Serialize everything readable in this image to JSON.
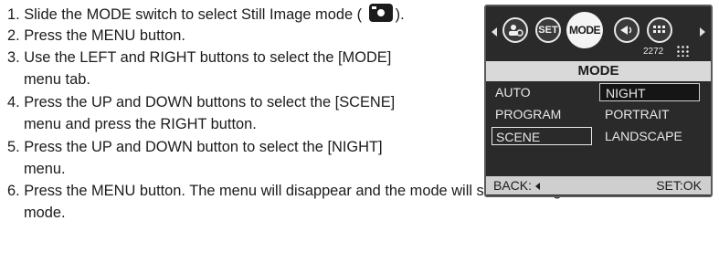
{
  "steps": [
    {
      "number": "1.",
      "text_before": "Slide the MODE switch to select Still Image mode (",
      "text_after": ").",
      "icon": "camera-icon"
    },
    {
      "number": "2.",
      "text": "Press the MENU button."
    },
    {
      "number": "3.",
      "text_line1": "Use the LEFT and RIGHT buttons to select the [MODE]",
      "text_line2": "menu tab."
    },
    {
      "number": "4.",
      "text_line1": "Press the UP and DOWN buttons to select the [SCENE]",
      "text_line2": "menu and press the RIGHT button."
    },
    {
      "number": "5.",
      "text_line1": "Press the UP and DOWN button to select the [NIGHT]",
      "text_line2": "menu."
    },
    {
      "number": "6.",
      "text_line1": "Press the MENU button. The menu will disappear and the mode will switch to Night scene",
      "text_line2": "mode."
    }
  ],
  "lcd": {
    "top_icons": [
      "person-icon",
      "set-icon",
      "mode-icon",
      "audio-icon",
      "grid-icon"
    ],
    "set_label": "SET",
    "mode_label": "MODE",
    "count": "2272",
    "title": "MODE",
    "menu_left": [
      "AUTO",
      "PROGRAM",
      "SCENE"
    ],
    "menu_right": [
      "NIGHT",
      "PORTRAIT",
      "LANDSCAPE"
    ],
    "back_label": "BACK:",
    "set_ok_label": "SET:OK",
    "colors": {
      "panel": "#2a2a2a",
      "bar": "#d9d9d9"
    }
  }
}
